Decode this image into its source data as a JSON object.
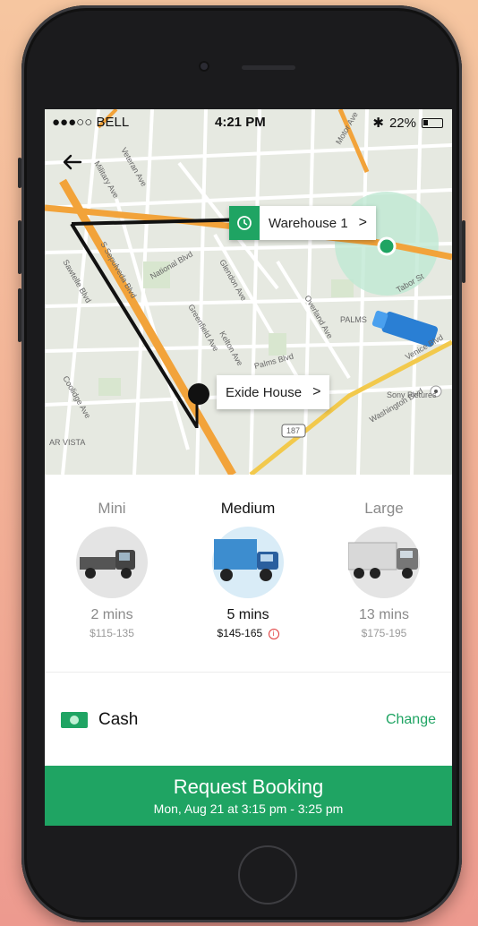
{
  "status_bar": {
    "carrier": "●●●○○ BELL",
    "time": "4:21 PM",
    "battery": "22%"
  },
  "map": {
    "pickup_label": "Warehouse 1",
    "dropoff_label": "Exide House",
    "street_labels": [
      "National Blvd",
      "Palms Blvd",
      "Overland Ave",
      "Motor Ave",
      "Sawtelle Blvd",
      "S Sepulveda Blvd",
      "Washington Blvd",
      "Venice Blvd",
      "Sony Pictures",
      "PALMS",
      "Tabor St",
      "Coolidge Ave",
      "Greenfield Ave",
      "Kelton Ave",
      "Glendon Ave",
      "Veteran Ave",
      "Military Ave",
      "187",
      "AR VISTA"
    ]
  },
  "vehicles": [
    {
      "name": "Mini",
      "eta": "2 mins",
      "price": "$115-135"
    },
    {
      "name": "Medium",
      "eta": "5 mins",
      "price": "$145-165"
    },
    {
      "name": "Large",
      "eta": "13 mins",
      "price": "$175-195"
    }
  ],
  "payment": {
    "method": "Cash",
    "change_label": "Change"
  },
  "request": {
    "title": "Request Booking",
    "subtitle": "Mon, Aug 21 at 3:15 pm - 3:25 pm"
  },
  "colors": {
    "accent": "#1fa463",
    "route": "#111111",
    "road_major": "#f2a33a"
  }
}
